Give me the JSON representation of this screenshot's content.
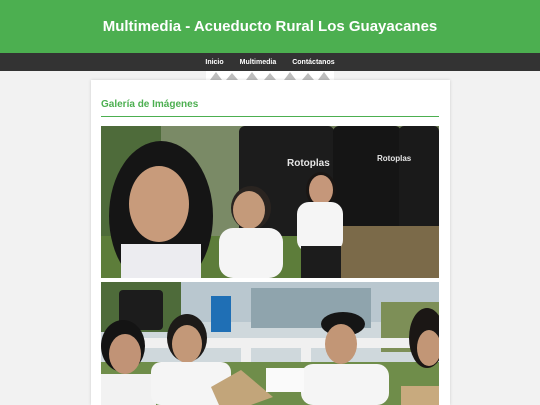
{
  "header": {
    "title": "Multimedia - Acueducto Rural Los Guayacanes"
  },
  "nav": {
    "items": [
      "Inicio",
      "Multimedia",
      "Contáctanos"
    ]
  },
  "gallery": {
    "title": "Galería de Imágenes",
    "tank_brand": "Rotoplas"
  },
  "colors": {
    "accent": "#4caf50",
    "nav_bg": "#333333"
  }
}
